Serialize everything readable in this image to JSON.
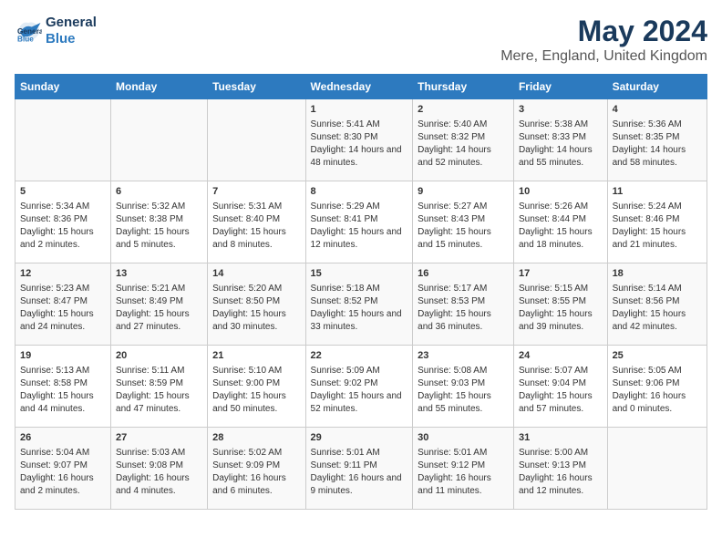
{
  "header": {
    "logo_line1": "General",
    "logo_line2": "Blue",
    "title": "May 2024",
    "subtitle": "Mere, England, United Kingdom"
  },
  "days_of_week": [
    "Sunday",
    "Monday",
    "Tuesday",
    "Wednesday",
    "Thursday",
    "Friday",
    "Saturday"
  ],
  "weeks": [
    [
      {
        "day": "",
        "content": ""
      },
      {
        "day": "",
        "content": ""
      },
      {
        "day": "",
        "content": ""
      },
      {
        "day": "1",
        "content": "Sunrise: 5:41 AM\nSunset: 8:30 PM\nDaylight: 14 hours and 48 minutes."
      },
      {
        "day": "2",
        "content": "Sunrise: 5:40 AM\nSunset: 8:32 PM\nDaylight: 14 hours and 52 minutes."
      },
      {
        "day": "3",
        "content": "Sunrise: 5:38 AM\nSunset: 8:33 PM\nDaylight: 14 hours and 55 minutes."
      },
      {
        "day": "4",
        "content": "Sunrise: 5:36 AM\nSunset: 8:35 PM\nDaylight: 14 hours and 58 minutes."
      }
    ],
    [
      {
        "day": "5",
        "content": "Sunrise: 5:34 AM\nSunset: 8:36 PM\nDaylight: 15 hours and 2 minutes."
      },
      {
        "day": "6",
        "content": "Sunrise: 5:32 AM\nSunset: 8:38 PM\nDaylight: 15 hours and 5 minutes."
      },
      {
        "day": "7",
        "content": "Sunrise: 5:31 AM\nSunset: 8:40 PM\nDaylight: 15 hours and 8 minutes."
      },
      {
        "day": "8",
        "content": "Sunrise: 5:29 AM\nSunset: 8:41 PM\nDaylight: 15 hours and 12 minutes."
      },
      {
        "day": "9",
        "content": "Sunrise: 5:27 AM\nSunset: 8:43 PM\nDaylight: 15 hours and 15 minutes."
      },
      {
        "day": "10",
        "content": "Sunrise: 5:26 AM\nSunset: 8:44 PM\nDaylight: 15 hours and 18 minutes."
      },
      {
        "day": "11",
        "content": "Sunrise: 5:24 AM\nSunset: 8:46 PM\nDaylight: 15 hours and 21 minutes."
      }
    ],
    [
      {
        "day": "12",
        "content": "Sunrise: 5:23 AM\nSunset: 8:47 PM\nDaylight: 15 hours and 24 minutes."
      },
      {
        "day": "13",
        "content": "Sunrise: 5:21 AM\nSunset: 8:49 PM\nDaylight: 15 hours and 27 minutes."
      },
      {
        "day": "14",
        "content": "Sunrise: 5:20 AM\nSunset: 8:50 PM\nDaylight: 15 hours and 30 minutes."
      },
      {
        "day": "15",
        "content": "Sunrise: 5:18 AM\nSunset: 8:52 PM\nDaylight: 15 hours and 33 minutes."
      },
      {
        "day": "16",
        "content": "Sunrise: 5:17 AM\nSunset: 8:53 PM\nDaylight: 15 hours and 36 minutes."
      },
      {
        "day": "17",
        "content": "Sunrise: 5:15 AM\nSunset: 8:55 PM\nDaylight: 15 hours and 39 minutes."
      },
      {
        "day": "18",
        "content": "Sunrise: 5:14 AM\nSunset: 8:56 PM\nDaylight: 15 hours and 42 minutes."
      }
    ],
    [
      {
        "day": "19",
        "content": "Sunrise: 5:13 AM\nSunset: 8:58 PM\nDaylight: 15 hours and 44 minutes."
      },
      {
        "day": "20",
        "content": "Sunrise: 5:11 AM\nSunset: 8:59 PM\nDaylight: 15 hours and 47 minutes."
      },
      {
        "day": "21",
        "content": "Sunrise: 5:10 AM\nSunset: 9:00 PM\nDaylight: 15 hours and 50 minutes."
      },
      {
        "day": "22",
        "content": "Sunrise: 5:09 AM\nSunset: 9:02 PM\nDaylight: 15 hours and 52 minutes."
      },
      {
        "day": "23",
        "content": "Sunrise: 5:08 AM\nSunset: 9:03 PM\nDaylight: 15 hours and 55 minutes."
      },
      {
        "day": "24",
        "content": "Sunrise: 5:07 AM\nSunset: 9:04 PM\nDaylight: 15 hours and 57 minutes."
      },
      {
        "day": "25",
        "content": "Sunrise: 5:05 AM\nSunset: 9:06 PM\nDaylight: 16 hours and 0 minutes."
      }
    ],
    [
      {
        "day": "26",
        "content": "Sunrise: 5:04 AM\nSunset: 9:07 PM\nDaylight: 16 hours and 2 minutes."
      },
      {
        "day": "27",
        "content": "Sunrise: 5:03 AM\nSunset: 9:08 PM\nDaylight: 16 hours and 4 minutes."
      },
      {
        "day": "28",
        "content": "Sunrise: 5:02 AM\nSunset: 9:09 PM\nDaylight: 16 hours and 6 minutes."
      },
      {
        "day": "29",
        "content": "Sunrise: 5:01 AM\nSunset: 9:11 PM\nDaylight: 16 hours and 9 minutes."
      },
      {
        "day": "30",
        "content": "Sunrise: 5:01 AM\nSunset: 9:12 PM\nDaylight: 16 hours and 11 minutes."
      },
      {
        "day": "31",
        "content": "Sunrise: 5:00 AM\nSunset: 9:13 PM\nDaylight: 16 hours and 12 minutes."
      },
      {
        "day": "",
        "content": ""
      }
    ]
  ]
}
